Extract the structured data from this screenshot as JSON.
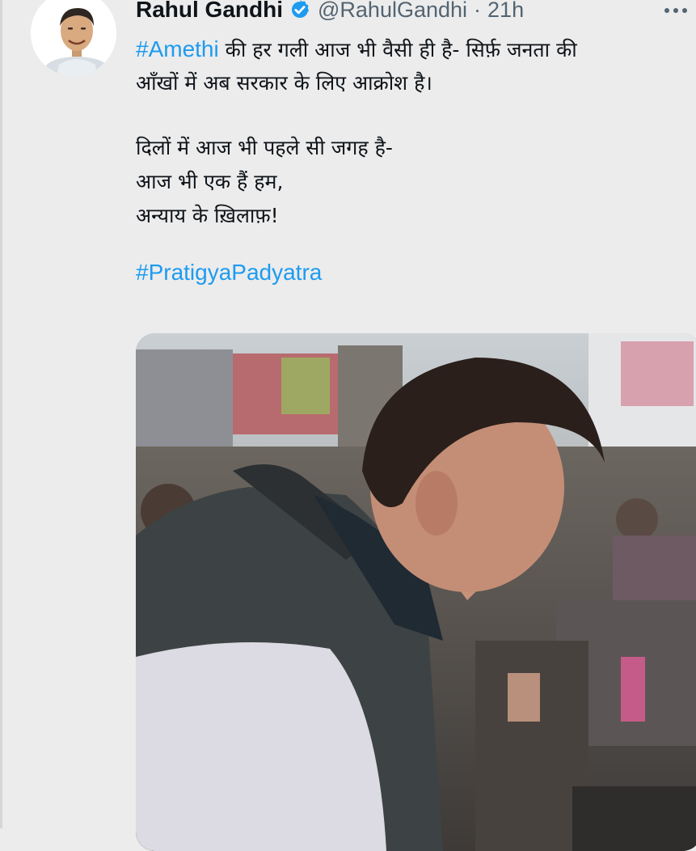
{
  "tweet": {
    "author_name": "Rahul Gandhi",
    "author_handle": "@RahulGandhi",
    "separator": "·",
    "timestamp": "21h",
    "line1_hashtag": "#Amethi",
    "line1_rest": " की हर गली आज भी वैसी ही है- सिर्फ़ जनता की",
    "line2": "आँखों में अब सरकार के लिए आक्रोश है।",
    "line3": "दिलों में आज भी पहले सी जगह है-",
    "line4": "आज भी एक हैं हम,",
    "line5": "अन्याय के ख़िलाफ़!",
    "hashtag2": "#PratigyaPadyatra"
  },
  "icons": {
    "verified": "verified-badge-icon",
    "more": "more-options-icon"
  },
  "colors": {
    "link": "#1d9bf0",
    "verified": "#1d9bf0",
    "secondary_text": "#536471",
    "background": "#ececec"
  }
}
